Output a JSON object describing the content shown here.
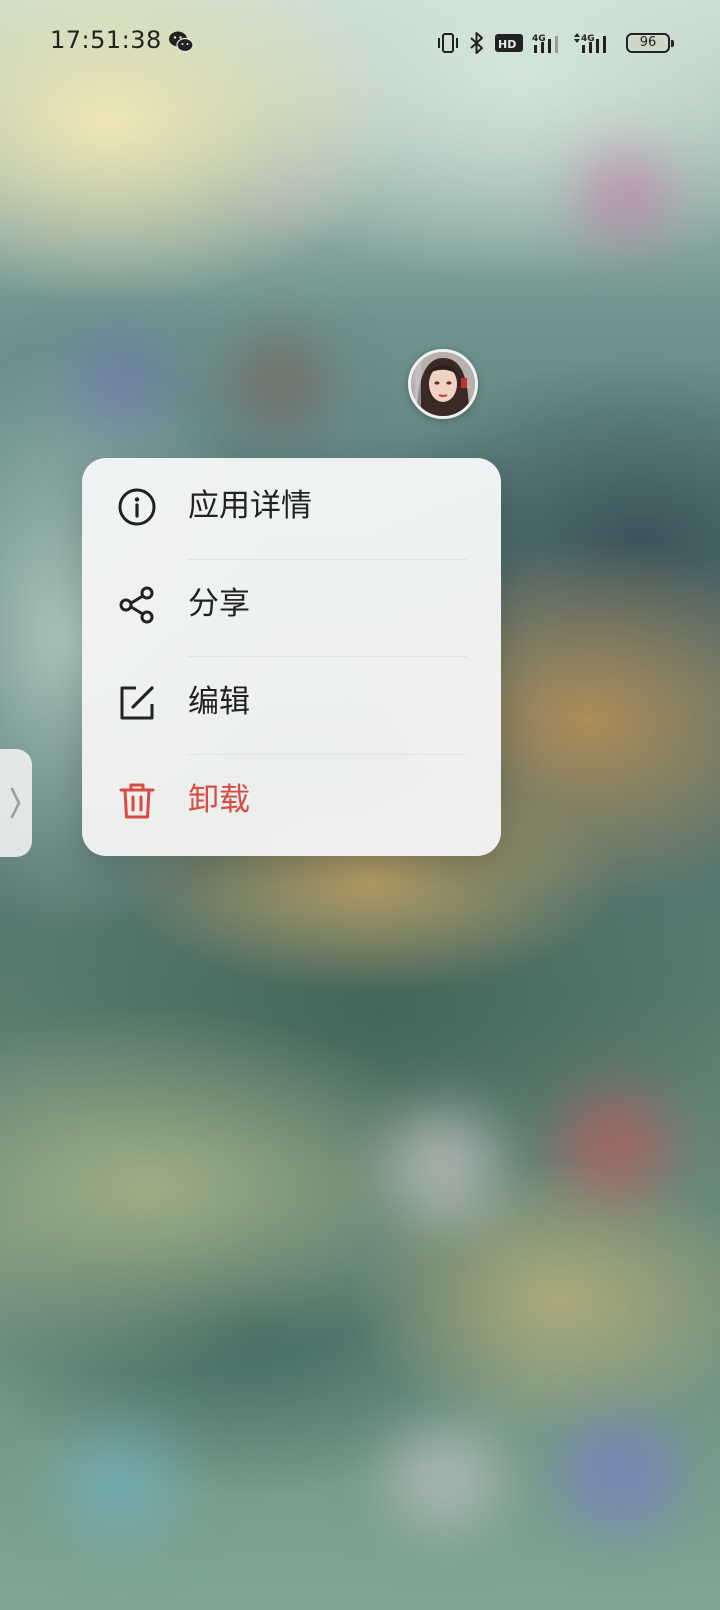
{
  "status_bar": {
    "time": "17:51:38",
    "network_badge": "HD",
    "network_1": "4G",
    "network_2": "4G",
    "battery_level": 96,
    "battery_text": "96",
    "icons": [
      "wechat-icon",
      "vibrate-icon",
      "bluetooth-icon",
      "hd-icon",
      "signal-icon",
      "signal-icon",
      "battery-icon"
    ]
  },
  "app": {
    "avatar_icon": "app-avatar"
  },
  "context_menu": {
    "items": [
      {
        "label": "应用详情",
        "icon": "info-icon"
      },
      {
        "label": "分享",
        "icon": "share-icon"
      },
      {
        "label": "编辑",
        "icon": "edit-icon"
      },
      {
        "label": "卸载",
        "icon": "trash-icon",
        "color": "#d94b43"
      }
    ]
  },
  "edge_handle": {
    "icon": "chevron-right-icon"
  }
}
